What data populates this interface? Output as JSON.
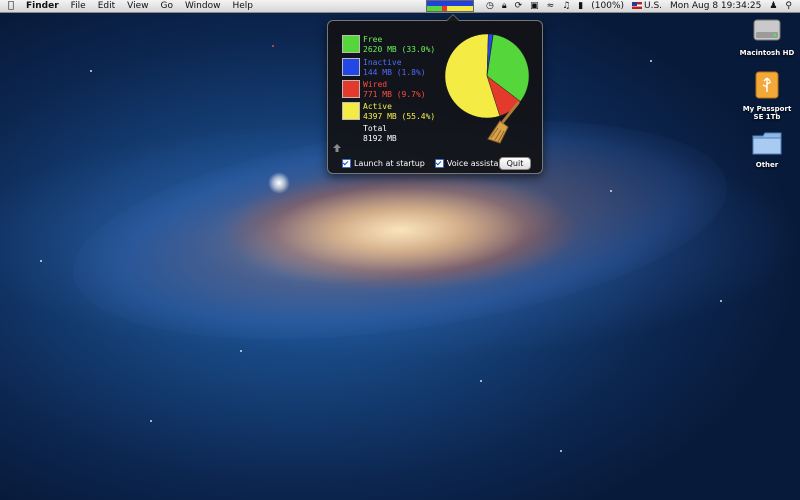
{
  "menubar": {
    "app": "Finder",
    "items": [
      "File",
      "Edit",
      "View",
      "Go",
      "Window",
      "Help"
    ],
    "battery": "(100%)",
    "input_source": "U.S.",
    "datetime": "Mon Aug 8  19:34:25",
    "status_icons": [
      "memory-icon",
      "time-machine-icon",
      "lock-icon",
      "sync-icon",
      "display-icon",
      "wifi-icon",
      "volume-icon",
      "battery-icon",
      "flag-icon",
      "user-icon",
      "spotlight-icon"
    ]
  },
  "memory": {
    "free_label": "Free",
    "free_value": "2620 MB (33.0%)",
    "inactive_label": "Inactive",
    "inactive_value": "144 MB (1.8%)",
    "wired_label": "Wired",
    "wired_value": "771 MB (9.7%)",
    "active_label": "Active",
    "active_value": "4397 MB (55.4%)",
    "total_label": "Total",
    "total_value": "8192 MB",
    "colors": {
      "free": "#55d63b",
      "inactive": "#2346e6",
      "wired": "#e43a2c",
      "active": "#f4ec44"
    },
    "fractions": {
      "free": 0.33,
      "inactive": 0.018,
      "wired": 0.097,
      "active": 0.554
    },
    "launch_label": "Launch at startup",
    "voice_label": "Voice assistant",
    "quit_label": "Quit"
  },
  "desktop": {
    "icons": [
      {
        "label": "Macintosh HD"
      },
      {
        "label": "My Passport SE 1Tb"
      },
      {
        "label": "Other"
      }
    ]
  }
}
